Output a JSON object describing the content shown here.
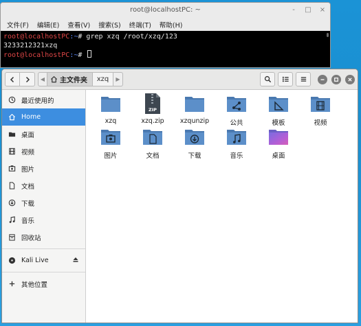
{
  "terminal": {
    "title": "root@localhostPC: ~",
    "controls": [
      "-",
      "□",
      "×"
    ],
    "menu": [
      "文件(F)",
      "编辑(E)",
      "查看(V)",
      "搜索(S)",
      "终端(T)",
      "帮助(H)"
    ],
    "lines": [
      {
        "user": "root@localhostPC",
        "path": ":~",
        "symbol": "# ",
        "command": "grep xzq /root/xzq/123"
      },
      {
        "output": "3233212321xzq"
      },
      {
        "user": "root@localhostPC",
        "path": ":~",
        "symbol": "# ",
        "command": ""
      }
    ]
  },
  "filemanager": {
    "path": {
      "home": "主文件夹",
      "current": "xzq"
    },
    "sidebar": {
      "places": [
        {
          "label": "最近使用的",
          "icon": "clock-icon"
        },
        {
          "label": "Home",
          "icon": "home-icon",
          "active": true
        },
        {
          "label": "桌面",
          "icon": "desktop-icon"
        },
        {
          "label": "视频",
          "icon": "film-icon"
        },
        {
          "label": "图片",
          "icon": "image-icon"
        },
        {
          "label": "文档",
          "icon": "document-icon"
        },
        {
          "label": "下载",
          "icon": "download-icon"
        },
        {
          "label": "音乐",
          "icon": "music-icon"
        },
        {
          "label": "回收站",
          "icon": "trash-icon"
        }
      ],
      "devices": [
        {
          "label": "Kali Live",
          "icon": "disc-icon"
        }
      ],
      "other": [
        {
          "label": "其他位置",
          "icon": "plus-icon"
        }
      ]
    },
    "files": [
      {
        "name": "xzq",
        "type": "folder"
      },
      {
        "name": "xzq.zip",
        "type": "zip",
        "badge": "ZIP"
      },
      {
        "name": "xzqunzip",
        "type": "folder"
      },
      {
        "name": "公共",
        "type": "folder-share"
      },
      {
        "name": "模板",
        "type": "folder-template"
      },
      {
        "name": "视频",
        "type": "folder-video"
      },
      {
        "name": "图片",
        "type": "folder-pictures"
      },
      {
        "name": "文档",
        "type": "folder-documents"
      },
      {
        "name": "下载",
        "type": "folder-download"
      },
      {
        "name": "音乐",
        "type": "folder-music"
      },
      {
        "name": "桌面",
        "type": "desktop"
      }
    ]
  },
  "colors": {
    "selection": "#3d8ee0",
    "folder": "#5c8fc9",
    "folderTab": "#4a79b0",
    "terminalBg": "#000000",
    "promptUser": "#e14747",
    "promptPath": "#5d8bff"
  }
}
